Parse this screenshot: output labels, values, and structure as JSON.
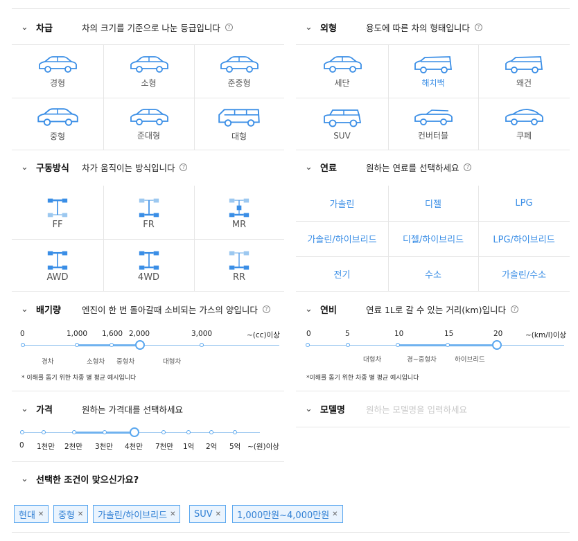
{
  "class_section": {
    "title": "차급",
    "desc": "차의 크기를 기준으로 나눈 등급입니다",
    "items": [
      "경형",
      "소형",
      "준중형",
      "중형",
      "준대형",
      "대형"
    ]
  },
  "shape_section": {
    "title": "외형",
    "desc": "용도에 따른 차의 형태입니다",
    "items": [
      "세단",
      "해치백",
      "왜건",
      "SUV",
      "컨버터블",
      "쿠페"
    ],
    "active": "해치백"
  },
  "drive_section": {
    "title": "구동방식",
    "desc": "차가 움직이는 방식입니다",
    "items": [
      "FF",
      "FR",
      "MR",
      "AWD",
      "4WD",
      "RR"
    ]
  },
  "fuel_section": {
    "title": "연료",
    "desc": "원하는 연료를 선택하세요",
    "items": [
      "가솔린",
      "디젤",
      "LPG",
      "가솔린/하이브리드",
      "디젤/하이브리드",
      "LPG/하이브리드",
      "전기",
      "수소",
      "가솔린/수소"
    ]
  },
  "displacement_section": {
    "title": "배기량",
    "desc": "엔진이 한 번 돌아갈때 소비되는 가스의 양입니다",
    "ticks": [
      "0",
      "1,000",
      "1,600",
      "2,000",
      "3,000",
      "~(cc)이상"
    ],
    "categories": [
      "경차",
      "소형차",
      "중형차",
      "대형차"
    ],
    "note": "* 이해를 돕기 위한 차종 별 평균 예시입니다",
    "selected_range": [
      "1,000",
      "2,000"
    ]
  },
  "efficiency_section": {
    "title": "연비",
    "desc": "연료 1L로 갈 수 있는 거리(km)입니다",
    "ticks": [
      "0",
      "5",
      "10",
      "15",
      "20",
      "~(km/l)이상"
    ],
    "categories": [
      "대형차",
      "경~중형차",
      "하이브리드"
    ],
    "note": "*이해를 돕기 위한 차종 별 평균 예시입니다",
    "selected_range": [
      "10",
      "20"
    ]
  },
  "price_section": {
    "title": "가격",
    "desc": "원하는 가격대를 선택하세요",
    "ticks": [
      "0",
      "1천만",
      "2천만",
      "3천만",
      "4천만",
      "7천만",
      "1억",
      "2억",
      "5억",
      "~(원)이상"
    ],
    "selected_range": [
      "2천만",
      "4천만"
    ]
  },
  "model_section": {
    "title": "모델명",
    "placeholder": "원하는 모델명을 입력하세요"
  },
  "summary": {
    "title": "선택한 조건이 맞으신가요?",
    "tags": [
      "현대",
      "중형",
      "가솔린/하이브리드",
      "SUV",
      "1,000만원~4,000만원"
    ]
  },
  "icons": {
    "chevron": "chevron-down-icon",
    "info": "info-icon",
    "remove": "close-icon"
  },
  "colors": {
    "accent": "#3a8ee6",
    "tag_bg": "#eaf4fe"
  }
}
